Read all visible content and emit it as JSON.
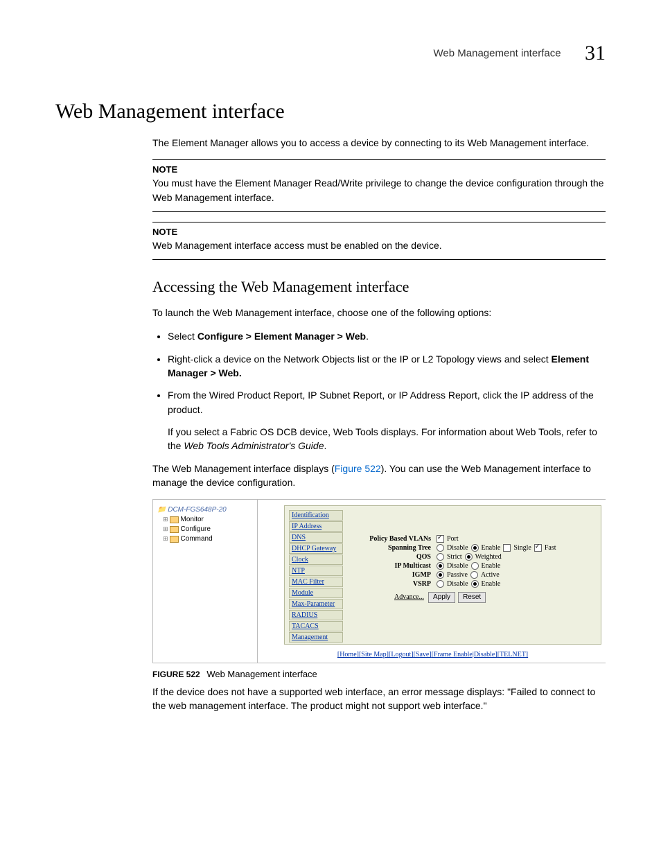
{
  "header": {
    "running_title": "Web Management interface",
    "chapter_number": "31"
  },
  "h1": "Web Management interface",
  "intro": "The Element Manager allows you to access a device by connecting to its Web Management interface.",
  "note1": {
    "label": "NOTE",
    "text": "You must have the Element Manager Read/Write privilege to change the device configuration through the Web Management interface."
  },
  "note2": {
    "label": "NOTE",
    "text": "Web Management interface access must be enabled on the device."
  },
  "h2": "Accessing the Web Management interface",
  "p_launch": "To launch the Web Management interface, choose one of the following options:",
  "bullets": [
    {
      "pre": "Select ",
      "bold": "Configure > Element Manager > Web",
      "post": "."
    },
    {
      "pre": "Right-click a device on the Network Objects list or the IP or L2 Topology views and select ",
      "bold": "Element Manager > Web.",
      "post": ""
    },
    {
      "pre": "From the Wired Product Report, IP Subnet Report, or IP Address Report, click the IP address of the product.",
      "bold": "",
      "post": ""
    }
  ],
  "p_fabric_pre": "If you select a Fabric OS DCB device, Web Tools displays. For information about Web Tools, refer to the ",
  "p_fabric_em": "Web Tools Administrator's Guide",
  "p_fabric_post": ".",
  "p_displays_pre": "The Web Management interface displays (",
  "p_displays_link": "Figure 522",
  "p_displays_post": "). You can use the Web Management interface to manage the device configuration.",
  "figure": {
    "caption_label": "FIGURE 522",
    "caption_text": "Web Management interface",
    "tree": {
      "root": "DCM-FGS648P-20",
      "nodes": [
        "Monitor",
        "Configure",
        "Command"
      ]
    },
    "side_links": [
      "Identification",
      "IP Address",
      "DNS",
      "DHCP Gateway",
      "Clock",
      "NTP",
      "MAC Filter",
      "Module",
      "Max-Parameter",
      "RADIUS",
      "TACACS",
      "Management"
    ],
    "settings": [
      {
        "label": "Policy Based VLANs",
        "opts": [
          {
            "k": "check",
            "sel": true,
            "t": "Port"
          }
        ]
      },
      {
        "label": "Spanning Tree",
        "opts": [
          {
            "k": "radio",
            "sel": false,
            "t": "Disable"
          },
          {
            "k": "radio",
            "sel": true,
            "t": "Enable"
          },
          {
            "k": "check",
            "sel": false,
            "t": "Single"
          },
          {
            "k": "check",
            "sel": true,
            "t": "Fast"
          }
        ]
      },
      {
        "label": "QOS",
        "opts": [
          {
            "k": "radio",
            "sel": false,
            "t": "Strict"
          },
          {
            "k": "radio",
            "sel": true,
            "t": "Weighted"
          }
        ]
      },
      {
        "label": "IP Multicast",
        "opts": [
          {
            "k": "radio",
            "sel": true,
            "t": "Disable"
          },
          {
            "k": "radio",
            "sel": false,
            "t": "Enable"
          }
        ]
      },
      {
        "label": "IGMP",
        "opts": [
          {
            "k": "radio",
            "sel": true,
            "t": "Passive"
          },
          {
            "k": "radio",
            "sel": false,
            "t": "Active"
          }
        ]
      },
      {
        "label": "VSRP",
        "opts": [
          {
            "k": "radio",
            "sel": false,
            "t": "Disable"
          },
          {
            "k": "radio",
            "sel": true,
            "t": "Enable"
          }
        ]
      }
    ],
    "advance": "Advance...",
    "apply": "Apply",
    "reset": "Reset",
    "bottom_links": [
      "[Home]",
      "[Site Map]",
      "[Logout]",
      "[Save]",
      "[Frame Enable|Disable]",
      "[TELNET]"
    ]
  },
  "p_error": "If the device does not have a supported web interface, an error message displays: \"Failed to connect to the web management interface. The product might not support web interface.\""
}
